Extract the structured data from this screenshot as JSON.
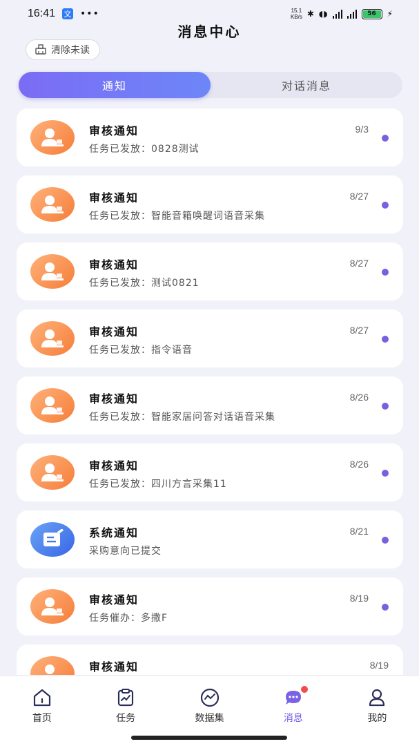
{
  "status_bar": {
    "time": "16:41",
    "app_badge": "文",
    "dots": "•••",
    "speed_top": "15.1",
    "speed_bottom": "KB/s",
    "battery": "56"
  },
  "header": {
    "title": "消息中心",
    "clear_label": "清除未读"
  },
  "tabs": [
    {
      "label": "通知",
      "active": true
    },
    {
      "label": "对话消息",
      "active": false
    }
  ],
  "messages": [
    {
      "type": "audit",
      "title": "审核通知",
      "subtitle": "任务已发放：0828测试",
      "date": "9/3",
      "unread": true
    },
    {
      "type": "audit",
      "title": "审核通知",
      "subtitle": "任务已发放：智能音箱唤醒词语音采集",
      "date": "8/27",
      "unread": true
    },
    {
      "type": "audit",
      "title": "审核通知",
      "subtitle": "任务已发放：测试0821",
      "date": "8/27",
      "unread": true
    },
    {
      "type": "audit",
      "title": "审核通知",
      "subtitle": "任务已发放：指令语音",
      "date": "8/27",
      "unread": true
    },
    {
      "type": "audit",
      "title": "审核通知",
      "subtitle": "任务已发放：智能家居问答对话语音采集",
      "date": "8/26",
      "unread": true
    },
    {
      "type": "audit",
      "title": "审核通知",
      "subtitle": "任务已发放：四川方言采集11",
      "date": "8/26",
      "unread": true
    },
    {
      "type": "system",
      "title": "系统通知",
      "subtitle": "采购意向已提交",
      "date": "8/21",
      "unread": true
    },
    {
      "type": "audit",
      "title": "审核通知",
      "subtitle": "任务催办：多撒F",
      "date": "8/19",
      "unread": true
    },
    {
      "type": "audit",
      "title": "审核通知",
      "subtitle": "",
      "date": "8/19",
      "unread": false
    }
  ],
  "nav": [
    {
      "label": "首页",
      "icon": "home-icon",
      "active": false
    },
    {
      "label": "任务",
      "icon": "task-icon",
      "active": false
    },
    {
      "label": "数据集",
      "icon": "dataset-icon",
      "active": false
    },
    {
      "label": "消息",
      "icon": "message-icon",
      "active": true
    },
    {
      "label": "我的",
      "icon": "profile-icon",
      "active": false
    }
  ],
  "colors": {
    "accent": "#6f5ce6",
    "audit_avatar": "#f78a46",
    "system_avatar": "#4677e8",
    "unread_dot": "#7a5fe0",
    "badge": "#f24b4b"
  }
}
